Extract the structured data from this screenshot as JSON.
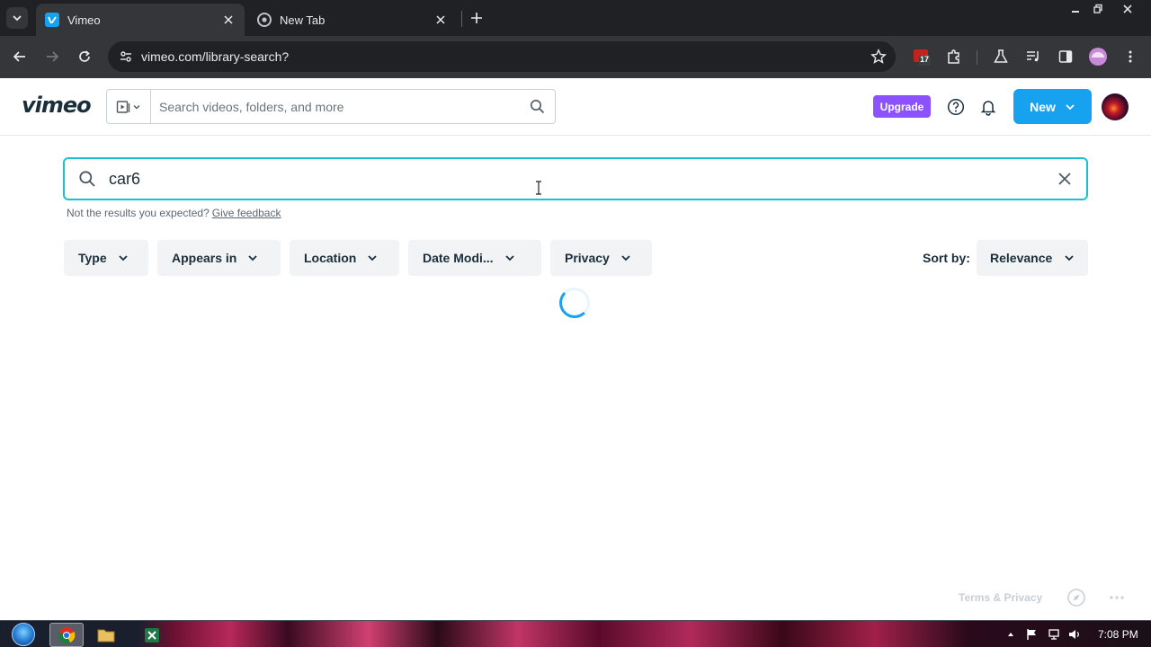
{
  "browser": {
    "tabs": [
      {
        "title": "Vimeo",
        "active": true
      },
      {
        "title": "New Tab",
        "active": false
      }
    ],
    "url": "vimeo.com/library-search?",
    "extension_badge": "17"
  },
  "header": {
    "logo": "vimeo",
    "search_placeholder": "Search videos, folders, and more",
    "upgrade_label": "Upgrade",
    "new_label": "New"
  },
  "search": {
    "value": "car6",
    "feedback_text": "Not the results you expected?",
    "feedback_link": "Give feedback"
  },
  "filters": [
    {
      "label": "Type"
    },
    {
      "label": "Appears in"
    },
    {
      "label": "Location"
    },
    {
      "label": "Date Modi..."
    },
    {
      "label": "Privacy"
    }
  ],
  "sort": {
    "label": "Sort by:",
    "value": "Relevance"
  },
  "footer": {
    "terms": "Terms & Privacy"
  },
  "taskbar": {
    "time": "7:08 PM"
  },
  "colors": {
    "accent": "#17a2f0",
    "focus_border": "#17c2d6",
    "upgrade": "#8c52ff",
    "logo": "#1a2e3b"
  }
}
